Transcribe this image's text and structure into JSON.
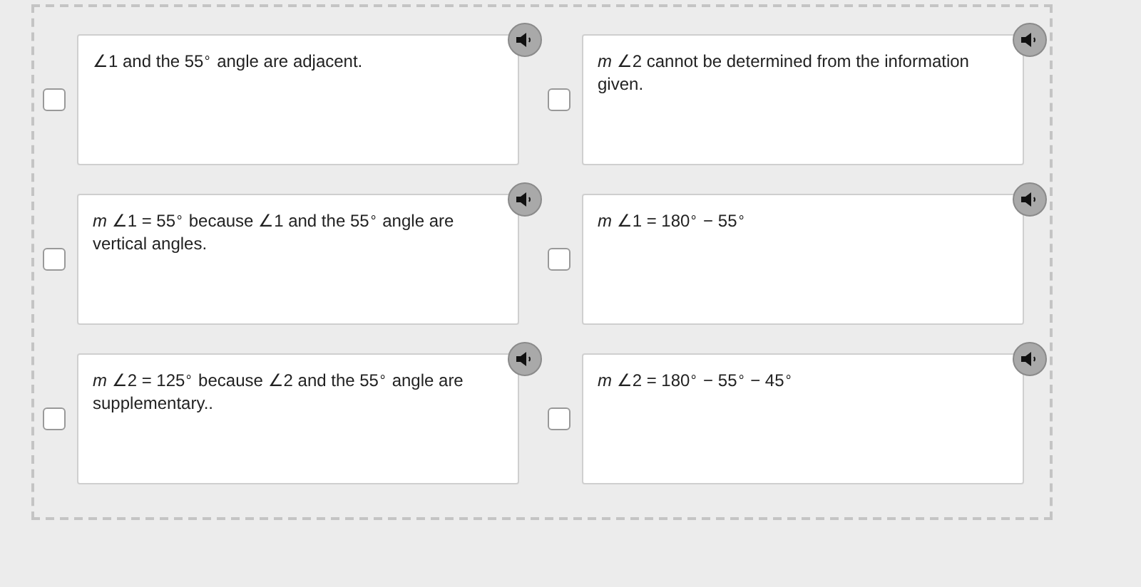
{
  "options": [
    {
      "text": "∠1 and the 55$^{∘}$ angle are adjacent.",
      "checked": false
    },
    {
      "text": "*m* ∠2 cannot be determined from the information given.",
      "checked": false
    },
    {
      "text": "*m* ∠1 = 55$^{∘}$ because ∠1 and the 55$^{∘}$ angle are vertical angles.",
      "checked": false
    },
    {
      "text": "*m* ∠1 = 180$^{∘}$ − 55$^{∘}$",
      "checked": false
    },
    {
      "text": "*m* ∠2 = 125$^{∘}$ because ∠2 and the 55$^{∘}$ angle are supplementary..",
      "checked": false
    },
    {
      "text": "*m* ∠2 = 180$^{∘}$ − 55$^{∘}$ − 45$^{∘}$",
      "checked": false
    }
  ]
}
